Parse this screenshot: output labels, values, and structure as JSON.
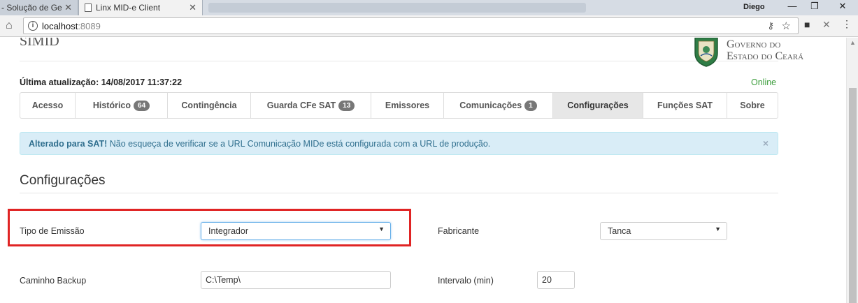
{
  "browser": {
    "tabs": [
      {
        "title": "- Solução de Ge"
      },
      {
        "title": "Linx MID-e Client"
      }
    ],
    "user": "Diego",
    "url_host": "localhost",
    "url_port": ":8089"
  },
  "header": {
    "brand_partial": "SIMID",
    "gov_line1": "Governo do",
    "gov_line2": "Estado do Ceará"
  },
  "status": {
    "last_update": "Última atualização: 14/08/2017 11:37:22",
    "connection": "Online"
  },
  "nav": {
    "tabs": [
      {
        "label": "Acesso",
        "badge": ""
      },
      {
        "label": "Histórico",
        "badge": "64"
      },
      {
        "label": "Contingência",
        "badge": ""
      },
      {
        "label": "Guarda CFe SAT",
        "badge": "13"
      },
      {
        "label": "Emissores",
        "badge": ""
      },
      {
        "label": "Comunicações",
        "badge": "1"
      },
      {
        "label": "Configurações",
        "badge": ""
      },
      {
        "label": "Funções SAT",
        "badge": ""
      },
      {
        "label": "Sobre",
        "badge": ""
      }
    ],
    "active": "Configurações"
  },
  "alert": {
    "strong": "Alterado para SAT!",
    "message": " Não esqueça de verificar se a URL Comunicação MIDe está configurada com a URL de produção.",
    "close": "×"
  },
  "config": {
    "title": "Configurações",
    "tipo_emissao": {
      "label": "Tipo de Emissão",
      "value": "Integrador"
    },
    "fabricante": {
      "label": "Fabricante",
      "value": "Tanca"
    },
    "caminho_backup": {
      "label": "Caminho Backup",
      "value": "C:\\Temp\\"
    },
    "intervalo": {
      "label": "Intervalo (min)",
      "value": "20"
    }
  },
  "colors": {
    "highlight_border": "#e02424",
    "alert_bg": "#d9edf7",
    "online": "#3c9d3c"
  }
}
